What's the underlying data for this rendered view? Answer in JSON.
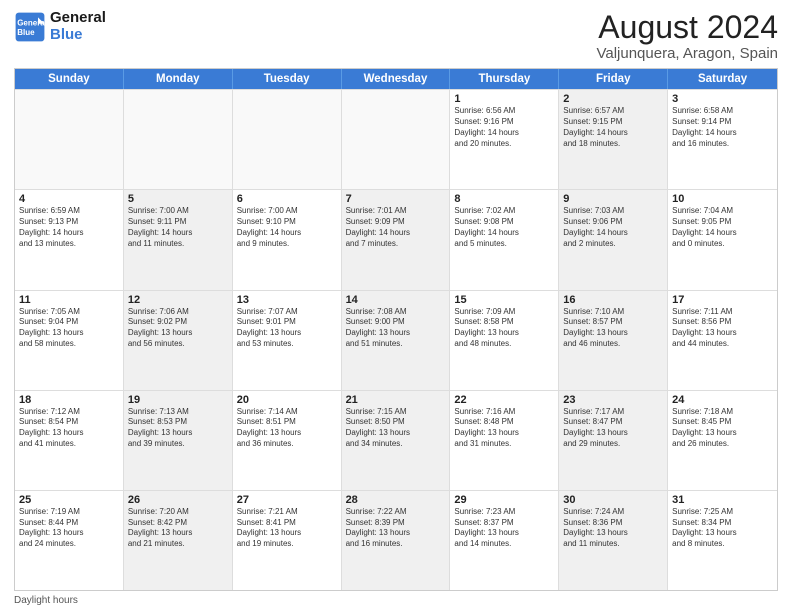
{
  "header": {
    "logo_line1": "General",
    "logo_line2": "Blue",
    "title": "August 2024",
    "subtitle": "Valjunquera, Aragon, Spain"
  },
  "days_of_week": [
    "Sunday",
    "Monday",
    "Tuesday",
    "Wednesday",
    "Thursday",
    "Friday",
    "Saturday"
  ],
  "footer": "Daylight hours",
  "weeks": [
    [
      {
        "day": "",
        "info": "",
        "empty": true
      },
      {
        "day": "",
        "info": "",
        "empty": true
      },
      {
        "day": "",
        "info": "",
        "empty": true
      },
      {
        "day": "",
        "info": "",
        "empty": true
      },
      {
        "day": "1",
        "info": "Sunrise: 6:56 AM\nSunset: 9:16 PM\nDaylight: 14 hours\nand 20 minutes.",
        "empty": false,
        "shaded": false
      },
      {
        "day": "2",
        "info": "Sunrise: 6:57 AM\nSunset: 9:15 PM\nDaylight: 14 hours\nand 18 minutes.",
        "empty": false,
        "shaded": true
      },
      {
        "day": "3",
        "info": "Sunrise: 6:58 AM\nSunset: 9:14 PM\nDaylight: 14 hours\nand 16 minutes.",
        "empty": false,
        "shaded": false
      }
    ],
    [
      {
        "day": "4",
        "info": "Sunrise: 6:59 AM\nSunset: 9:13 PM\nDaylight: 14 hours\nand 13 minutes.",
        "empty": false,
        "shaded": false
      },
      {
        "day": "5",
        "info": "Sunrise: 7:00 AM\nSunset: 9:11 PM\nDaylight: 14 hours\nand 11 minutes.",
        "empty": false,
        "shaded": true
      },
      {
        "day": "6",
        "info": "Sunrise: 7:00 AM\nSunset: 9:10 PM\nDaylight: 14 hours\nand 9 minutes.",
        "empty": false,
        "shaded": false
      },
      {
        "day": "7",
        "info": "Sunrise: 7:01 AM\nSunset: 9:09 PM\nDaylight: 14 hours\nand 7 minutes.",
        "empty": false,
        "shaded": true
      },
      {
        "day": "8",
        "info": "Sunrise: 7:02 AM\nSunset: 9:08 PM\nDaylight: 14 hours\nand 5 minutes.",
        "empty": false,
        "shaded": false
      },
      {
        "day": "9",
        "info": "Sunrise: 7:03 AM\nSunset: 9:06 PM\nDaylight: 14 hours\nand 2 minutes.",
        "empty": false,
        "shaded": true
      },
      {
        "day": "10",
        "info": "Sunrise: 7:04 AM\nSunset: 9:05 PM\nDaylight: 14 hours\nand 0 minutes.",
        "empty": false,
        "shaded": false
      }
    ],
    [
      {
        "day": "11",
        "info": "Sunrise: 7:05 AM\nSunset: 9:04 PM\nDaylight: 13 hours\nand 58 minutes.",
        "empty": false,
        "shaded": false
      },
      {
        "day": "12",
        "info": "Sunrise: 7:06 AM\nSunset: 9:02 PM\nDaylight: 13 hours\nand 56 minutes.",
        "empty": false,
        "shaded": true
      },
      {
        "day": "13",
        "info": "Sunrise: 7:07 AM\nSunset: 9:01 PM\nDaylight: 13 hours\nand 53 minutes.",
        "empty": false,
        "shaded": false
      },
      {
        "day": "14",
        "info": "Sunrise: 7:08 AM\nSunset: 9:00 PM\nDaylight: 13 hours\nand 51 minutes.",
        "empty": false,
        "shaded": true
      },
      {
        "day": "15",
        "info": "Sunrise: 7:09 AM\nSunset: 8:58 PM\nDaylight: 13 hours\nand 48 minutes.",
        "empty": false,
        "shaded": false
      },
      {
        "day": "16",
        "info": "Sunrise: 7:10 AM\nSunset: 8:57 PM\nDaylight: 13 hours\nand 46 minutes.",
        "empty": false,
        "shaded": true
      },
      {
        "day": "17",
        "info": "Sunrise: 7:11 AM\nSunset: 8:56 PM\nDaylight: 13 hours\nand 44 minutes.",
        "empty": false,
        "shaded": false
      }
    ],
    [
      {
        "day": "18",
        "info": "Sunrise: 7:12 AM\nSunset: 8:54 PM\nDaylight: 13 hours\nand 41 minutes.",
        "empty": false,
        "shaded": false
      },
      {
        "day": "19",
        "info": "Sunrise: 7:13 AM\nSunset: 8:53 PM\nDaylight: 13 hours\nand 39 minutes.",
        "empty": false,
        "shaded": true
      },
      {
        "day": "20",
        "info": "Sunrise: 7:14 AM\nSunset: 8:51 PM\nDaylight: 13 hours\nand 36 minutes.",
        "empty": false,
        "shaded": false
      },
      {
        "day": "21",
        "info": "Sunrise: 7:15 AM\nSunset: 8:50 PM\nDaylight: 13 hours\nand 34 minutes.",
        "empty": false,
        "shaded": true
      },
      {
        "day": "22",
        "info": "Sunrise: 7:16 AM\nSunset: 8:48 PM\nDaylight: 13 hours\nand 31 minutes.",
        "empty": false,
        "shaded": false
      },
      {
        "day": "23",
        "info": "Sunrise: 7:17 AM\nSunset: 8:47 PM\nDaylight: 13 hours\nand 29 minutes.",
        "empty": false,
        "shaded": true
      },
      {
        "day": "24",
        "info": "Sunrise: 7:18 AM\nSunset: 8:45 PM\nDaylight: 13 hours\nand 26 minutes.",
        "empty": false,
        "shaded": false
      }
    ],
    [
      {
        "day": "25",
        "info": "Sunrise: 7:19 AM\nSunset: 8:44 PM\nDaylight: 13 hours\nand 24 minutes.",
        "empty": false,
        "shaded": false
      },
      {
        "day": "26",
        "info": "Sunrise: 7:20 AM\nSunset: 8:42 PM\nDaylight: 13 hours\nand 21 minutes.",
        "empty": false,
        "shaded": true
      },
      {
        "day": "27",
        "info": "Sunrise: 7:21 AM\nSunset: 8:41 PM\nDaylight: 13 hours\nand 19 minutes.",
        "empty": false,
        "shaded": false
      },
      {
        "day": "28",
        "info": "Sunrise: 7:22 AM\nSunset: 8:39 PM\nDaylight: 13 hours\nand 16 minutes.",
        "empty": false,
        "shaded": true
      },
      {
        "day": "29",
        "info": "Sunrise: 7:23 AM\nSunset: 8:37 PM\nDaylight: 13 hours\nand 14 minutes.",
        "empty": false,
        "shaded": false
      },
      {
        "day": "30",
        "info": "Sunrise: 7:24 AM\nSunset: 8:36 PM\nDaylight: 13 hours\nand 11 minutes.",
        "empty": false,
        "shaded": true
      },
      {
        "day": "31",
        "info": "Sunrise: 7:25 AM\nSunset: 8:34 PM\nDaylight: 13 hours\nand 8 minutes.",
        "empty": false,
        "shaded": false
      }
    ]
  ]
}
